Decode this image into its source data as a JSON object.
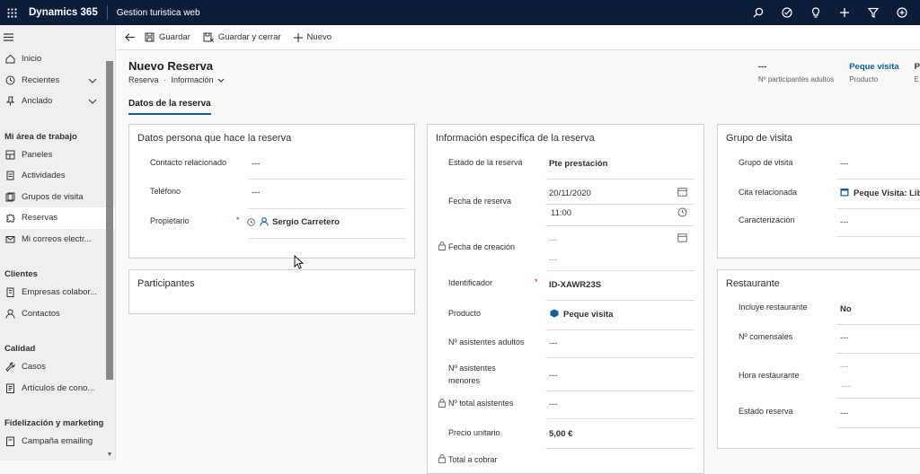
{
  "topbar": {
    "brand": "Dynamics 365",
    "app_title": "Gestion turistica web",
    "icons": [
      "search-icon",
      "task-icon",
      "lightbulb-icon",
      "plus-icon",
      "filter-icon",
      "settings-icon"
    ]
  },
  "sidebar": {
    "items": [
      {
        "label": "Inicio",
        "icon": "home-icon"
      },
      {
        "label": "Recientes",
        "icon": "clock-icon"
      },
      {
        "label": "Anclado",
        "icon": "pin-icon"
      }
    ],
    "groups": [
      {
        "title": "Mi área de trabajo",
        "items": [
          {
            "label": "Paneles"
          },
          {
            "label": "Actividades"
          },
          {
            "label": "Grupos de visita"
          },
          {
            "label": "Reservas"
          },
          {
            "label": "Mi correos electr..."
          }
        ]
      },
      {
        "title": "Clientes",
        "items": [
          {
            "label": "Empresas colabor..."
          },
          {
            "label": "Contactos"
          }
        ]
      },
      {
        "title": "Calidad",
        "items": [
          {
            "label": "Casos"
          },
          {
            "label": "Artículos de cono..."
          }
        ]
      },
      {
        "title": "Fidelización y marketing",
        "items": [
          {
            "label": "Campaña emailing"
          }
        ]
      }
    ]
  },
  "cmdbar": {
    "save": "Guardar",
    "save_close": "Guardar y cerrar",
    "new": "Nuevo"
  },
  "header": {
    "title": "Nuevo Reserva",
    "entity": "Reserva",
    "separator": "·",
    "form": "Información",
    "fields": [
      {
        "value": "---",
        "label": "Nº participantes adultos"
      },
      {
        "value": "Peque visita",
        "label": "Producto"
      },
      {
        "value": "P",
        "label": "E"
      }
    ]
  },
  "tabs": {
    "active": "Datos de la reserva"
  },
  "sec_persona": {
    "title": "Datos persona que hace la reserva",
    "contacto_label": "Contacto relacionado",
    "contacto_value": "---",
    "telefono_label": "Teléfono",
    "telefono_value": "---",
    "propietario_label": "Propietario",
    "propietario_value": "Sergio Carretero",
    "required": "*"
  },
  "sec_participantes": {
    "title": "Participantes"
  },
  "sec_info": {
    "title": "Información específica de la reserva",
    "estado_label": "Estado de la reserva",
    "estado_value": "Pte prestación",
    "fecha_label": "Fecha de reserva",
    "fecha_date": "20/11/2020",
    "fecha_time": "11:00",
    "creacion_label": "Fecha de creación",
    "creacion_date": "---",
    "creacion_time": "---",
    "id_label": "Identificador",
    "id_value": "ID-XAWR23S",
    "producto_label": "Producto",
    "producto_value": "Peque visita",
    "adultos_label": "Nº asistentes adultos",
    "adultos_value": "---",
    "menores_label_1": "Nº asistentes",
    "menores_label_2": "menores",
    "menores_value": "---",
    "total_label": "Nº total asistentes",
    "total_value": "---",
    "precio_label": "Precio unitario",
    "precio_value": "5,00 €",
    "cobrar_label": "Total a cobrar",
    "required": "*"
  },
  "sec_grupo": {
    "title": "Grupo de visita",
    "grupo_label": "Grupo de visita",
    "grupo_value": "---",
    "cita_label": "Cita relacionada",
    "cita_value": "Peque Visita: Libr",
    "caract_label": "Caracterización",
    "caract_value": "---"
  },
  "sec_rest": {
    "title": "Restaurante",
    "incluye_label": "Incluye restaurante",
    "incluye_value": "No",
    "comensales_label": "Nº comensales",
    "comensales_value": "---",
    "hora_label": "Hora restaurante",
    "hora_value1": "---",
    "hora_value2": "---",
    "estado_label": "Estado reserva",
    "estado_value": "---"
  }
}
